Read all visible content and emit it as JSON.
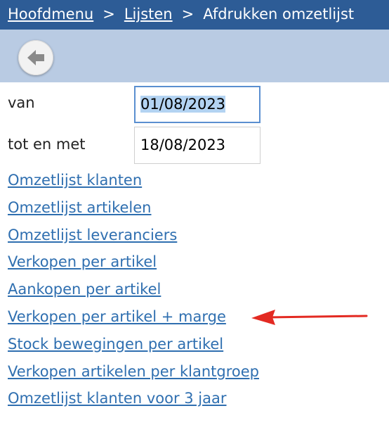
{
  "breadcrumb": {
    "home": "Hoofdmenu",
    "separator": ">",
    "lists": "Lijsten",
    "current": "Afdrukken omzetlijst"
  },
  "toolbar": {
    "back_icon": "arrow-left-icon"
  },
  "form": {
    "from_label": "van",
    "from_value": "01/08/2023",
    "to_label": "tot en met",
    "to_value": "18/08/2023"
  },
  "links": [
    "Omzetlijst klanten",
    "Omzetlijst artikelen",
    "Omzetlijst leveranciers",
    "Verkopen per artikel",
    "Aankopen per artikel",
    "Verkopen per artikel + marge",
    "Stock bewegingen per artikel",
    "Verkopen artikelen per klantgroep",
    "Omzetlijst klanten voor 3 jaar"
  ],
  "annotation": {
    "arrow_color": "#e32a22"
  },
  "colors": {
    "header_bg": "#2d5c96",
    "toolbar_bg": "#b9cbe3",
    "link": "#2f6fb0"
  }
}
